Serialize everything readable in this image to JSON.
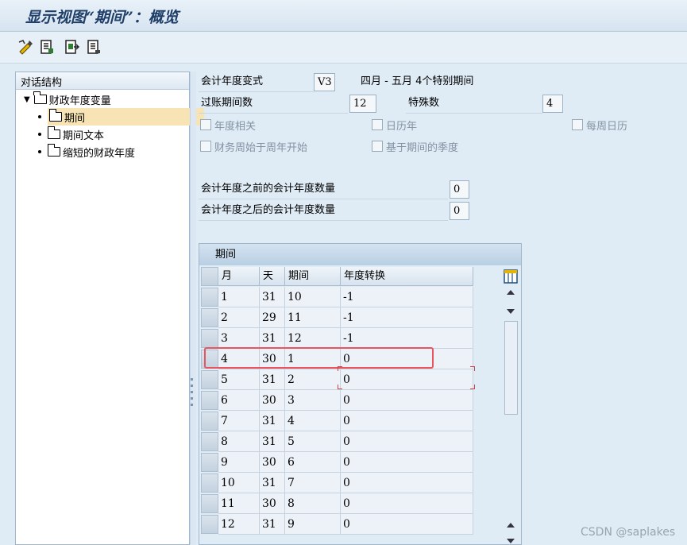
{
  "title": "显示视图“期间”：概览",
  "toolbar": {
    "icons": [
      "edit-display-icon",
      "document-icon",
      "export-icon",
      "document-list-icon"
    ]
  },
  "tree": {
    "header": "对话结构",
    "root_label": "财政年度变量",
    "items": [
      {
        "label": "期间",
        "selected": true
      },
      {
        "label": "期间文本",
        "selected": false
      },
      {
        "label": "缩短的财政年度",
        "selected": false
      }
    ]
  },
  "form": {
    "variant_label": "会计年度变式",
    "variant_value": "V3",
    "variant_desc": "四月 - 五月 4个特别期间",
    "posting_periods_label": "过账期间数",
    "posting_periods_value": "12",
    "special_periods_label": "特殊数",
    "special_periods_value": "4",
    "cb_year_dependent": "年度相关",
    "cb_calendar_year": "日历年",
    "cb_weekly_calendar": "每周日历",
    "cb_fin_week_start": "财务周始于周年开始",
    "cb_period_quarter": "基于期间的季度",
    "years_before_label": "会计年度之前的会计年度数量",
    "years_before_value": "0",
    "years_after_label": "会计年度之后的会计年度数量",
    "years_after_value": "0"
  },
  "table": {
    "title": "期间",
    "columns": [
      "月",
      "天",
      "期间",
      "年度转换"
    ],
    "rows": [
      [
        "1",
        "31",
        "10",
        "-1"
      ],
      [
        "2",
        "29",
        "11",
        "-1"
      ],
      [
        "3",
        "31",
        "12",
        "-1"
      ],
      [
        "4",
        "30",
        "1",
        "0"
      ],
      [
        "5",
        "31",
        "2",
        "0"
      ],
      [
        "6",
        "30",
        "3",
        "0"
      ],
      [
        "7",
        "31",
        "4",
        "0"
      ],
      [
        "8",
        "31",
        "5",
        "0"
      ],
      [
        "9",
        "30",
        "6",
        "0"
      ],
      [
        "10",
        "31",
        "7",
        "0"
      ],
      [
        "11",
        "30",
        "8",
        "0"
      ],
      [
        "12",
        "31",
        "9",
        "0"
      ]
    ],
    "highlighted_row": 3
  },
  "watermark": "CSDN @saplakes",
  "colors": {
    "accent_title": "#1f3f69",
    "highlight_border": "#e9545f",
    "selected_tree": "#f7e3b3"
  }
}
